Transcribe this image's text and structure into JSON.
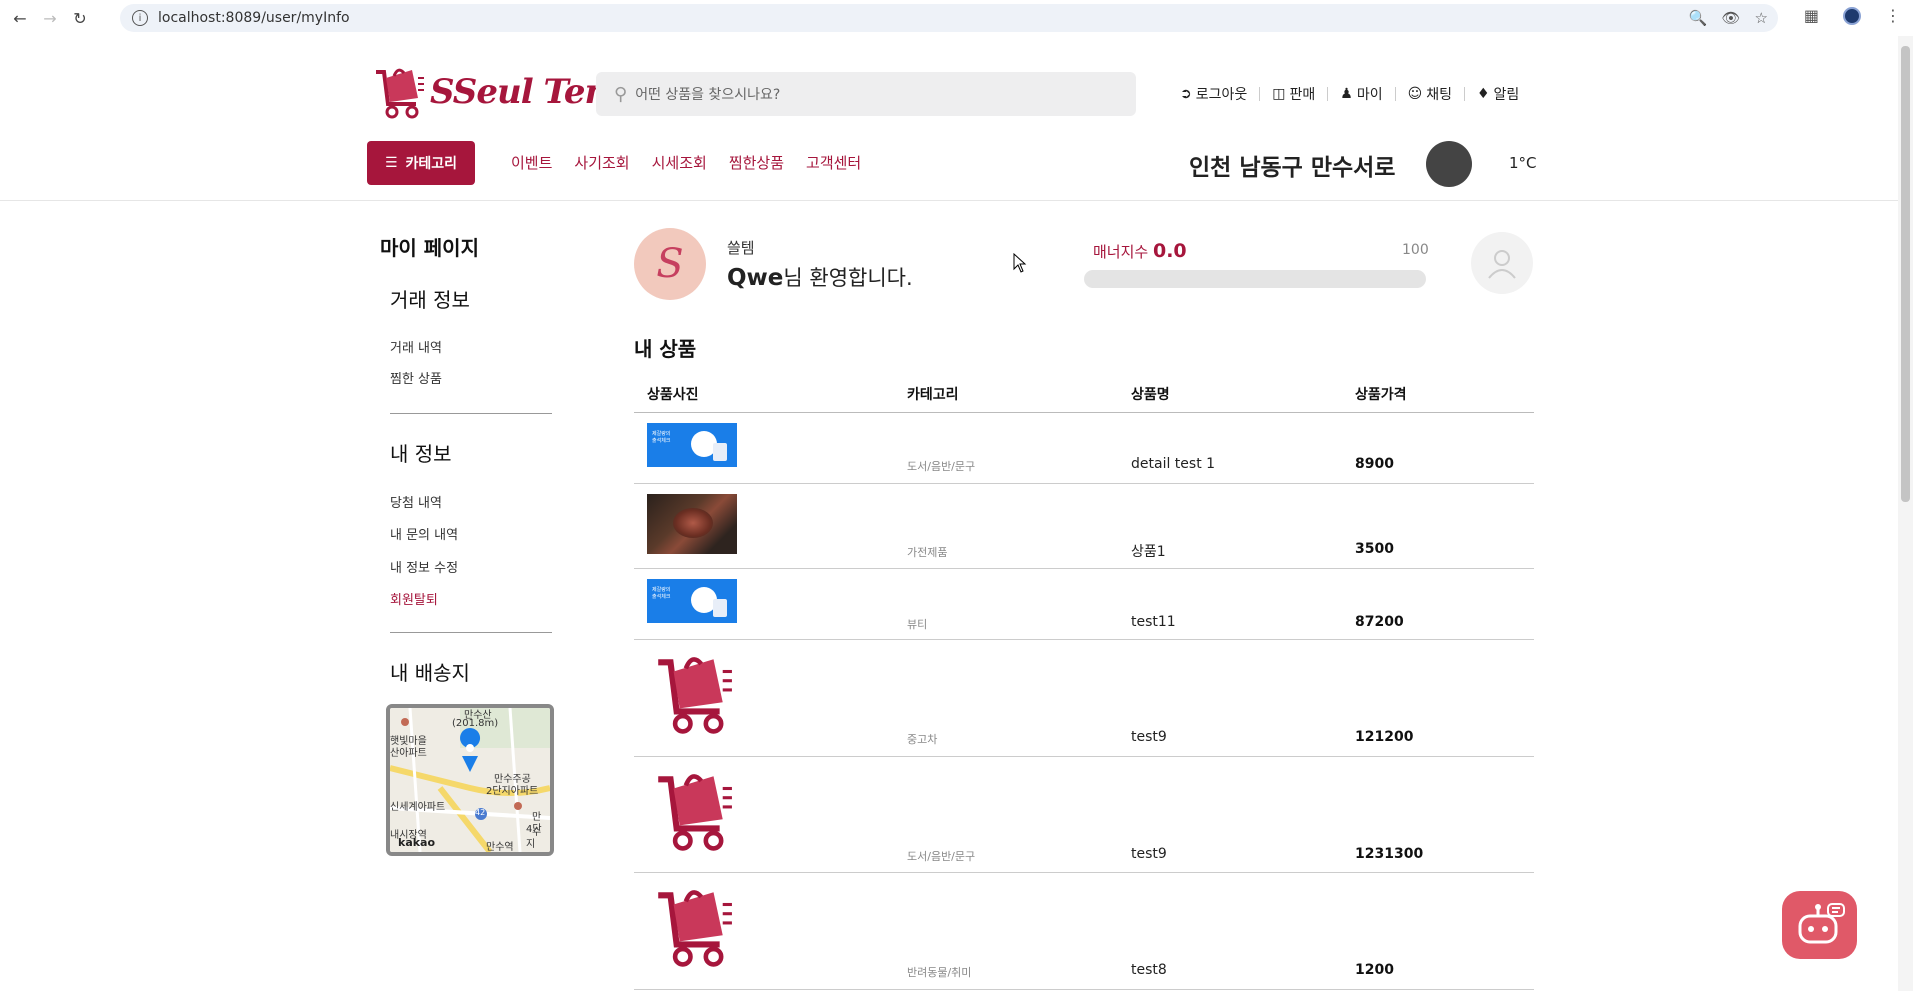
{
  "browser": {
    "url": "localhost:8089/user/myInfo"
  },
  "header": {
    "logo_text": "SSeul Tem",
    "search_placeholder": "어떤 상품을 찾으시나요?",
    "links": [
      {
        "label": "로그아웃",
        "icon": "logout-icon"
      },
      {
        "label": "판매",
        "icon": "sell-icon"
      },
      {
        "label": "마이",
        "icon": "user-icon"
      },
      {
        "label": "채팅",
        "icon": "chat-icon"
      },
      {
        "label": "알림",
        "icon": "bell-icon"
      }
    ],
    "category_button": "카테고리",
    "menus": [
      "이벤트",
      "사기조회",
      "시세조회",
      "찜한상품",
      "고객센터"
    ],
    "location": "인천 남동구 만수서로",
    "temperature": "1°C"
  },
  "sidebar": {
    "title": "마이 페이지",
    "trade_title": "거래 정보",
    "trade_links": [
      "거래 내역",
      "찜한 상품"
    ],
    "info_title": "내 정보",
    "info_links": [
      "당첨 내역",
      "내 문의 내역",
      "내 정보 수정"
    ],
    "withdraw": "회원탈퇴",
    "address_title": "내 배송지",
    "map": {
      "labels": [
        "만수산",
        "(201.8m)",
        "햇빛마을",
        "산아파트",
        "만수주공",
        "2단지아파트",
        "신세계아파트",
        "내시장역",
        "만수역",
        "만수",
        "4단지",
        "42"
      ],
      "brand": "kakao"
    }
  },
  "profile": {
    "avatar_letter": "S",
    "shop_name": "쓸템",
    "user_name": "Qwe",
    "welcome_suffix": "님 환영합니다.",
    "manner_label": "매너지수",
    "manner_value": "0.0",
    "manner_max": "100",
    "manner_fraction": 0
  },
  "products": {
    "title": "내 상품",
    "headers": [
      "상품사진",
      "카테고리",
      "상품명",
      "상품가격"
    ],
    "rows": [
      {
        "category": "도서/음반/문구",
        "name": "detail test 1",
        "price": "8900",
        "image": "blue-banner"
      },
      {
        "category": "가전제품",
        "name": "상품1",
        "price": "3500",
        "image": "food-photo"
      },
      {
        "category": "뷰티",
        "name": "test11",
        "price": "87200",
        "image": "blue-banner"
      },
      {
        "category": "중고차",
        "name": "test9",
        "price": "121200",
        "image": "cart-logo"
      },
      {
        "category": "도서/음반/문구",
        "name": "test9",
        "price": "1231300",
        "image": "cart-logo"
      },
      {
        "category": "반려동물/취미",
        "name": "test8",
        "price": "1200",
        "image": "cart-logo"
      }
    ]
  },
  "colors": {
    "brand": "#a6163c",
    "chatbot": "#e05968"
  }
}
